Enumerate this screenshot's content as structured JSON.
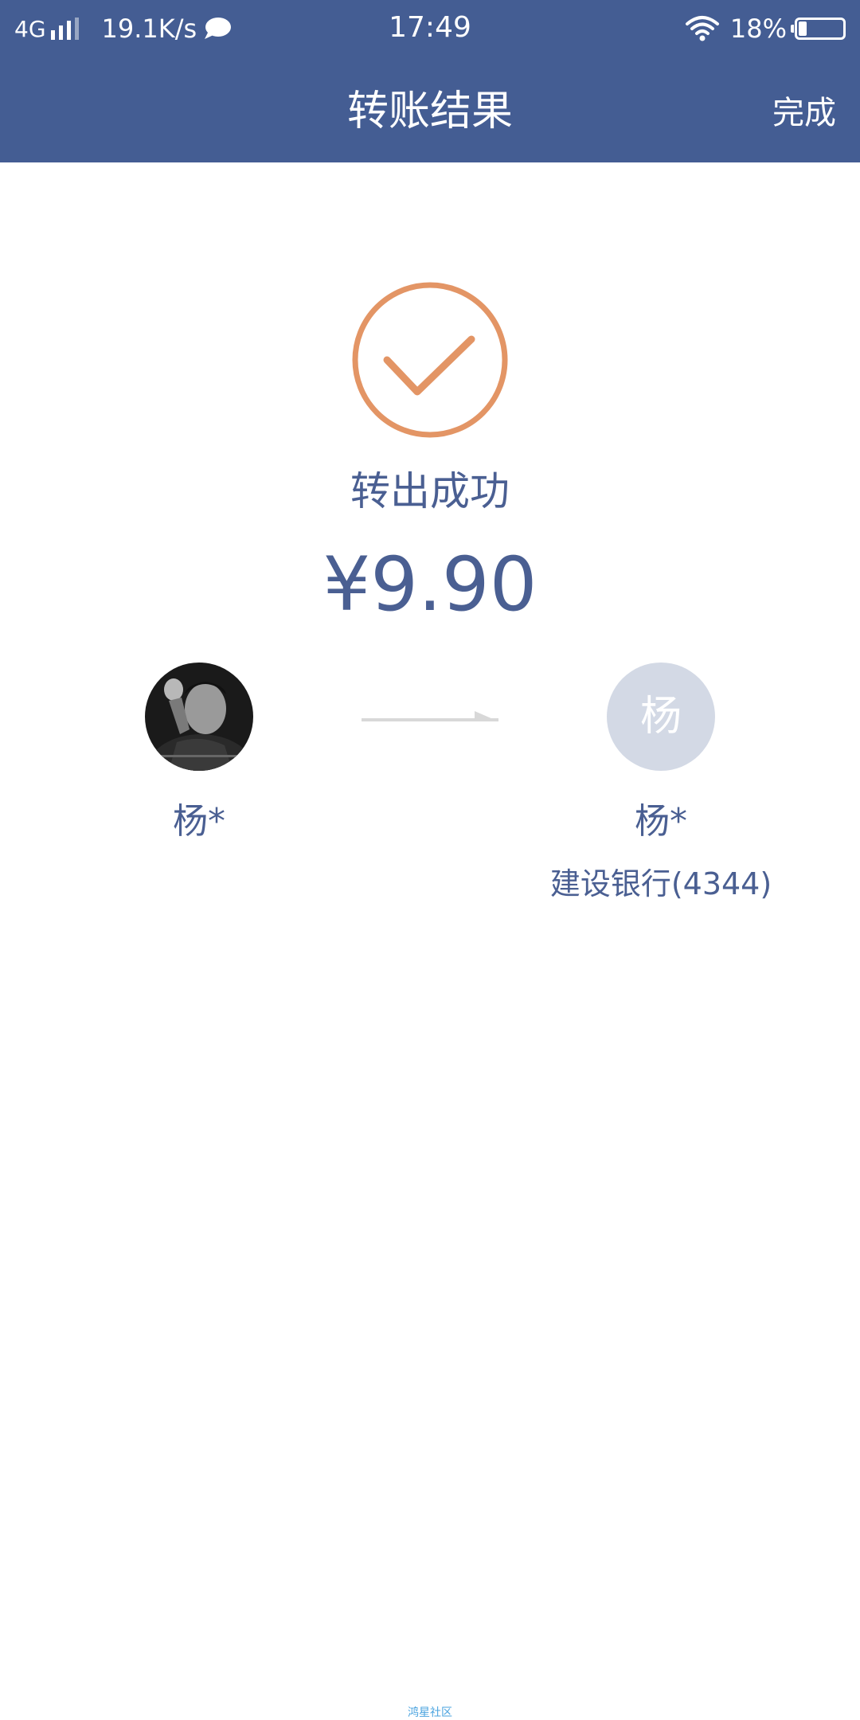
{
  "status_bar": {
    "network": "4G",
    "speed": "19.1K/s",
    "time": "17:49",
    "battery": "18%",
    "battery_level": 0.18
  },
  "nav": {
    "title": "转账结果",
    "done_label": "完成"
  },
  "result": {
    "status": "转出成功",
    "amount": "¥9.90"
  },
  "sender": {
    "name": "杨*"
  },
  "recipient": {
    "avatar_char": "杨",
    "name": "杨*",
    "bank": "建设银行(4344)"
  },
  "footer": {
    "watermark": "鸿星社区"
  },
  "colors": {
    "header_bg": "#445d93",
    "text_primary": "#4a5f92",
    "success_accent": "#e39565",
    "recipient_avatar_bg": "#d3d9e5",
    "arrow": "#d8d8d8"
  },
  "icons": {
    "success": "check-circle-icon",
    "transfer": "arrow-right-icon",
    "wifi": "wifi-icon",
    "battery": "battery-icon",
    "chat": "chat-bubble-icon",
    "signal": "signal-bars-icon"
  }
}
